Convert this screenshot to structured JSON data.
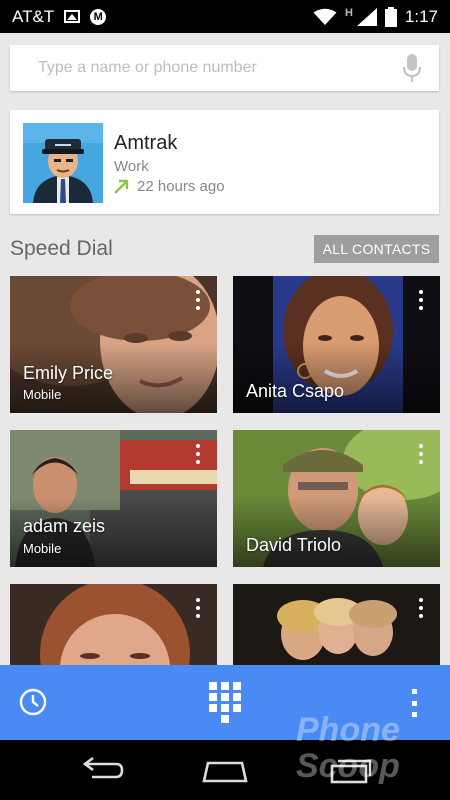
{
  "status_bar": {
    "carrier": "AT&T",
    "network_type": "H",
    "time": "1:17",
    "icons": [
      "image-icon",
      "motorola-icon",
      "wifi-icon",
      "signal-icon",
      "battery-icon"
    ]
  },
  "search": {
    "placeholder": "Type a name or phone number",
    "value": "",
    "icon": "microphone-icon"
  },
  "recent_contact": {
    "name": "Amtrak",
    "phone_type": "Work",
    "call_time": "22 hours ago",
    "call_direction_icon": "outgoing-call-arrow-icon",
    "arrow_color": "#8bc34a"
  },
  "speed_dial": {
    "title": "Speed Dial",
    "all_contacts_label": "ALL CONTACTS",
    "contacts": [
      {
        "name": "Emily Price",
        "label": "Mobile"
      },
      {
        "name": "Anita Csapo",
        "label": ""
      },
      {
        "name": "adam zeis",
        "label": "Mobile"
      },
      {
        "name": "David Triolo",
        "label": ""
      },
      {
        "name": "",
        "label": ""
      },
      {
        "name": "",
        "label": ""
      }
    ]
  },
  "action_bar": {
    "color": "#4a8af4",
    "icons": [
      "history-icon",
      "dialpad-icon",
      "overflow-menu-icon"
    ]
  },
  "nav_bar": {
    "icons": [
      "back-icon",
      "home-icon",
      "recents-icon"
    ]
  },
  "watermark": {
    "text": "Phone Scoop"
  }
}
